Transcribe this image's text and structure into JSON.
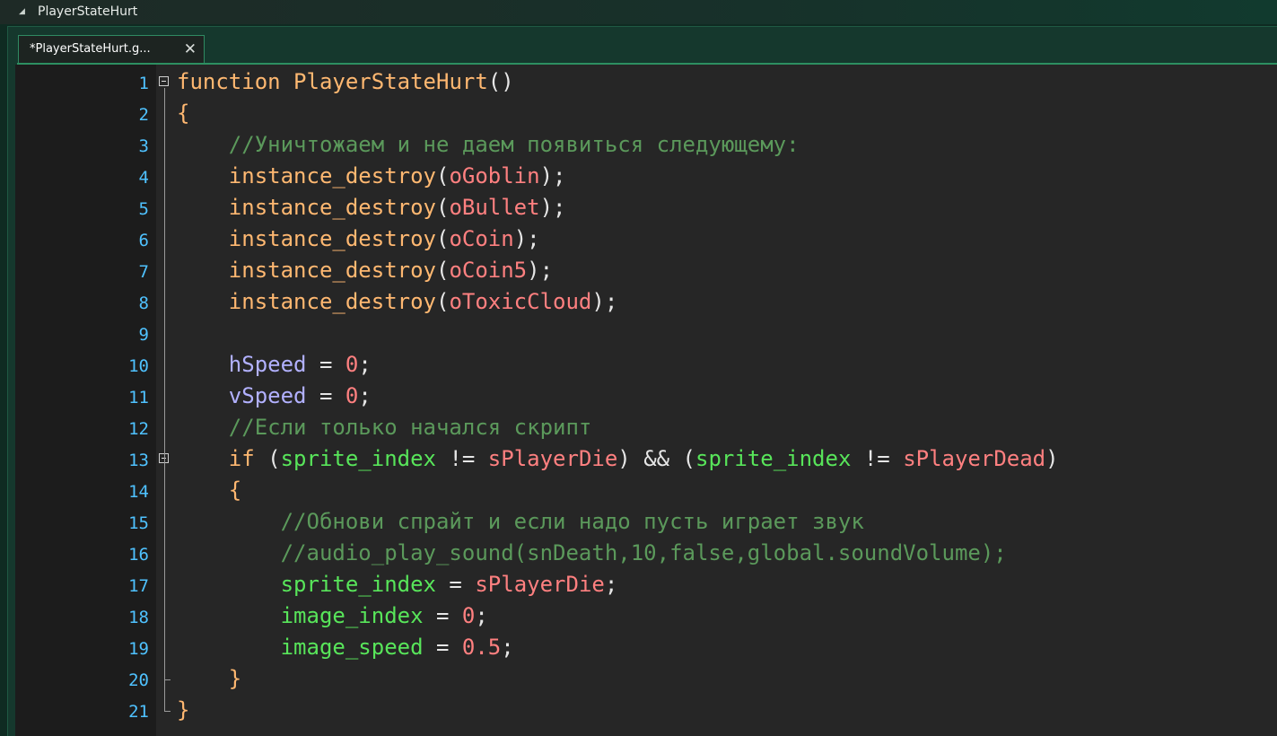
{
  "window": {
    "title": "PlayerStateHurt"
  },
  "tab": {
    "label": "*PlayerStateHurt.g...",
    "close": "✕"
  },
  "lines": [
    {
      "n": "1",
      "tokens": [
        [
          "kw",
          "function"
        ],
        [
          "op",
          " "
        ],
        [
          "fn",
          "PlayerStateHurt"
        ],
        [
          "op",
          "()"
        ]
      ],
      "fold": true
    },
    {
      "n": "2",
      "tokens": [
        [
          "kw",
          "{"
        ]
      ]
    },
    {
      "n": "3",
      "tokens": [
        [
          "op",
          "    "
        ],
        [
          "cm",
          "//Уничтожаем и не даем появиться следующему:"
        ]
      ]
    },
    {
      "n": "4",
      "tokens": [
        [
          "op",
          "    "
        ],
        [
          "fn",
          "instance_destroy"
        ],
        [
          "op",
          "("
        ],
        [
          "res",
          "oGoblin"
        ],
        [
          "op",
          ");"
        ]
      ]
    },
    {
      "n": "5",
      "tokens": [
        [
          "op",
          "    "
        ],
        [
          "fn",
          "instance_destroy"
        ],
        [
          "op",
          "("
        ],
        [
          "res",
          "oBullet"
        ],
        [
          "op",
          ");"
        ]
      ]
    },
    {
      "n": "6",
      "tokens": [
        [
          "op",
          "    "
        ],
        [
          "fn",
          "instance_destroy"
        ],
        [
          "op",
          "("
        ],
        [
          "res",
          "oCoin"
        ],
        [
          "op",
          ");"
        ]
      ]
    },
    {
      "n": "7",
      "tokens": [
        [
          "op",
          "    "
        ],
        [
          "fn",
          "instance_destroy"
        ],
        [
          "op",
          "("
        ],
        [
          "res",
          "oCoin5"
        ],
        [
          "op",
          ");"
        ]
      ]
    },
    {
      "n": "8",
      "tokens": [
        [
          "op",
          "    "
        ],
        [
          "fn",
          "instance_destroy"
        ],
        [
          "op",
          "("
        ],
        [
          "res",
          "oToxicCloud"
        ],
        [
          "op",
          ");"
        ]
      ]
    },
    {
      "n": "9",
      "tokens": []
    },
    {
      "n": "10",
      "tokens": [
        [
          "op",
          "    "
        ],
        [
          "var",
          "hSpeed"
        ],
        [
          "op",
          " = "
        ],
        [
          "num",
          "0"
        ],
        [
          "op",
          ";"
        ]
      ]
    },
    {
      "n": "11",
      "tokens": [
        [
          "op",
          "    "
        ],
        [
          "var",
          "vSpeed"
        ],
        [
          "op",
          " = "
        ],
        [
          "num",
          "0"
        ],
        [
          "op",
          ";"
        ]
      ]
    },
    {
      "n": "12",
      "tokens": [
        [
          "op",
          "    "
        ],
        [
          "cm",
          "//Если только начался скрипт"
        ]
      ]
    },
    {
      "n": "13",
      "tokens": [
        [
          "op",
          "    "
        ],
        [
          "kw",
          "if"
        ],
        [
          "op",
          " ("
        ],
        [
          "bvar",
          "sprite_index"
        ],
        [
          "op",
          " != "
        ],
        [
          "res",
          "sPlayerDie"
        ],
        [
          "op",
          ") && ("
        ],
        [
          "bvar",
          "sprite_index"
        ],
        [
          "op",
          " != "
        ],
        [
          "res",
          "sPlayerDead"
        ],
        [
          "op",
          ")"
        ]
      ],
      "fold": true
    },
    {
      "n": "14",
      "tokens": [
        [
          "op",
          "    "
        ],
        [
          "kw",
          "{"
        ]
      ]
    },
    {
      "n": "15",
      "tokens": [
        [
          "op",
          "        "
        ],
        [
          "cm",
          "//Обнови спрайт и если надо пусть играет звук"
        ]
      ]
    },
    {
      "n": "16",
      "tokens": [
        [
          "op",
          "        "
        ],
        [
          "cm",
          "//audio_play_sound(snDeath,10,false,global.soundVolume);"
        ]
      ]
    },
    {
      "n": "17",
      "tokens": [
        [
          "op",
          "        "
        ],
        [
          "bvar",
          "sprite_index"
        ],
        [
          "op",
          " = "
        ],
        [
          "res",
          "sPlayerDie"
        ],
        [
          "op",
          ";"
        ]
      ]
    },
    {
      "n": "18",
      "tokens": [
        [
          "op",
          "        "
        ],
        [
          "bvar",
          "image_index"
        ],
        [
          "op",
          " = "
        ],
        [
          "num",
          "0"
        ],
        [
          "op",
          ";"
        ]
      ]
    },
    {
      "n": "19",
      "tokens": [
        [
          "op",
          "        "
        ],
        [
          "bvar",
          "image_speed"
        ],
        [
          "op",
          " = "
        ],
        [
          "num",
          "0.5"
        ],
        [
          "op",
          ";"
        ]
      ]
    },
    {
      "n": "20",
      "tokens": [
        [
          "op",
          "    "
        ],
        [
          "kw",
          "}"
        ]
      ]
    },
    {
      "n": "21",
      "tokens": [
        [
          "kw",
          "}"
        ]
      ]
    }
  ],
  "colors": {
    "keyword": "#ffb871",
    "comment": "#5b995b",
    "resource": "#ff8080",
    "number": "#ff8080",
    "instance_var": "#b2b1ff",
    "builtin_var": "#58e55a",
    "line_number": "#4fc2ff",
    "background": "#262626"
  }
}
